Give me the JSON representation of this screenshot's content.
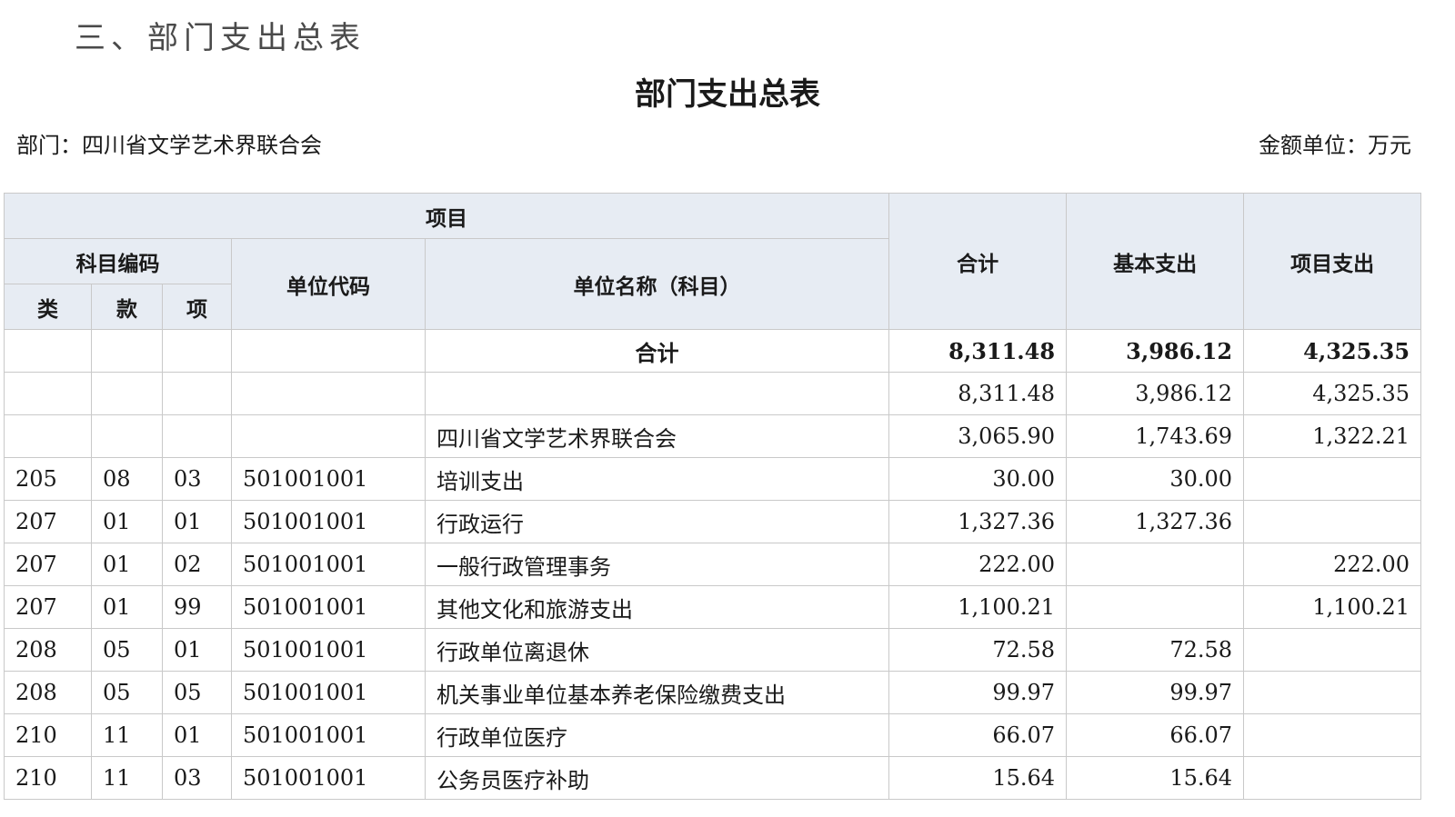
{
  "section_heading": "三、部门支出总表",
  "title": "部门支出总表",
  "department_label": "部门：四川省文学艺术界联合会",
  "unit_label": "金额单位：万元",
  "headers": {
    "project": "项目",
    "subject_code": "科目编码",
    "lei": "类",
    "kuan": "款",
    "xiang": "项",
    "unit_code": "单位代码",
    "unit_name": "单位名称（科目）",
    "total": "合计",
    "basic": "基本支出",
    "project_exp": "项目支出"
  },
  "rows": [
    {
      "lei": "",
      "kuan": "",
      "xiang": "",
      "code": "",
      "name": "合计",
      "total": "8,311.48",
      "basic": "3,986.12",
      "project": "4,325.35",
      "bold": true
    },
    {
      "lei": "",
      "kuan": "",
      "xiang": "",
      "code": "",
      "name": "",
      "total": "8,311.48",
      "basic": "3,986.12",
      "project": "4,325.35"
    },
    {
      "lei": "",
      "kuan": "",
      "xiang": "",
      "code": "",
      "name": "四川省文学艺术界联合会",
      "total": "3,065.90",
      "basic": "1,743.69",
      "project": "1,322.21"
    },
    {
      "lei": "205",
      "kuan": "08",
      "xiang": "03",
      "code": "501001001",
      "name": "培训支出",
      "total": "30.00",
      "basic": "30.00",
      "project": ""
    },
    {
      "lei": "207",
      "kuan": "01",
      "xiang": "01",
      "code": "501001001",
      "name": "行政运行",
      "total": "1,327.36",
      "basic": "1,327.36",
      "project": ""
    },
    {
      "lei": "207",
      "kuan": "01",
      "xiang": "02",
      "code": "501001001",
      "name": "一般行政管理事务",
      "total": "222.00",
      "basic": "",
      "project": "222.00"
    },
    {
      "lei": "207",
      "kuan": "01",
      "xiang": "99",
      "code": "501001001",
      "name": "其他文化和旅游支出",
      "total": "1,100.21",
      "basic": "",
      "project": "1,100.21"
    },
    {
      "lei": "208",
      "kuan": "05",
      "xiang": "01",
      "code": "501001001",
      "name": "行政单位离退休",
      "total": "72.58",
      "basic": "72.58",
      "project": ""
    },
    {
      "lei": "208",
      "kuan": "05",
      "xiang": "05",
      "code": "501001001",
      "name": "机关事业单位基本养老保险缴费支出",
      "total": "99.97",
      "basic": "99.97",
      "project": ""
    },
    {
      "lei": "210",
      "kuan": "11",
      "xiang": "01",
      "code": "501001001",
      "name": "行政单位医疗",
      "total": "66.07",
      "basic": "66.07",
      "project": ""
    },
    {
      "lei": "210",
      "kuan": "11",
      "xiang": "03",
      "code": "501001001",
      "name": "公务员医疗补助",
      "total": "15.64",
      "basic": "15.64",
      "project": ""
    }
  ]
}
